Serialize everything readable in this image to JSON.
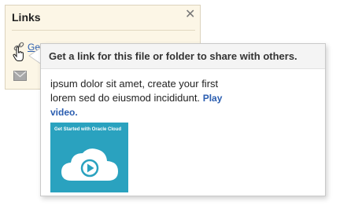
{
  "links_panel": {
    "title": "Links",
    "link_text": "Get",
    "close_icon": "close-icon",
    "link_icon": "link-icon",
    "cursor_icon": "hand-cursor-icon",
    "mail_icon": "mail-icon"
  },
  "callout": {
    "title": "Get a link for this file or folder to share with others.",
    "body_text": "ipsum dolor sit amet, create your first lorem sed do eiusmod incididunt.",
    "play_link": "Play video.",
    "video_caption": "Get Started with Oracle Cloud",
    "video_icon": "cloud-play-icon"
  },
  "colors": {
    "panel_background": "#fcf6e6",
    "link": "#2a5db0",
    "video_background": "#2aa2bf"
  }
}
